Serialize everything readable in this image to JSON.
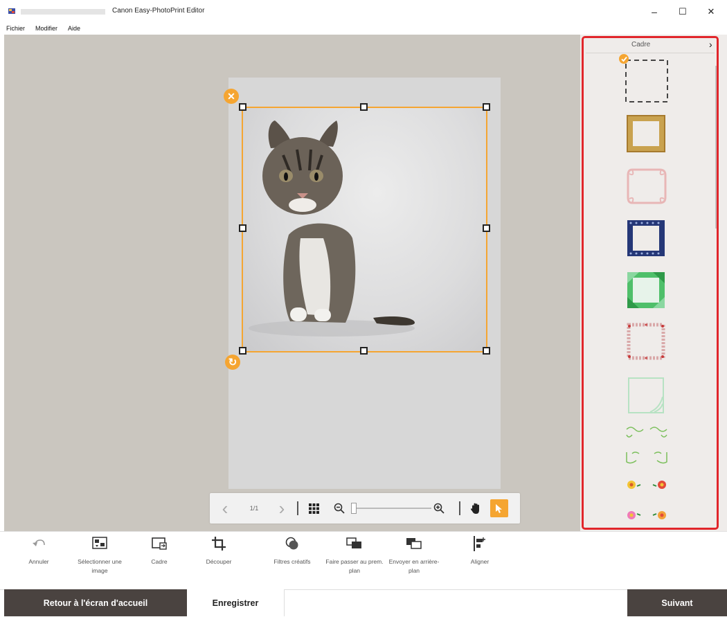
{
  "window": {
    "title": "Canon Easy-PhotoPrint Editor",
    "minimize_label": "–",
    "maximize_label": "☐",
    "close_label": "✕"
  },
  "menu": {
    "items": [
      "Fichier",
      "Modifier",
      "Aide"
    ]
  },
  "canvas": {
    "remove_glyph": "✕",
    "rotate_glyph": "↻"
  },
  "navigation": {
    "prev_glyph": "‹",
    "page_indicator": "1/1",
    "next_glyph": "›",
    "zoom_level": 0.02
  },
  "panel": {
    "title": "Cadre",
    "close_glyph": "›",
    "frames": [
      {
        "name": "none",
        "selected": true
      },
      {
        "name": "gold",
        "selected": false
      },
      {
        "name": "pink-ornate",
        "selected": false
      },
      {
        "name": "navy-dots",
        "selected": false
      },
      {
        "name": "green-geometric",
        "selected": false
      },
      {
        "name": "floral-red",
        "selected": false
      },
      {
        "name": "mint-corner",
        "selected": false
      },
      {
        "name": "green-vines",
        "selected": false
      },
      {
        "name": "green-vines-2",
        "selected": false
      },
      {
        "name": "flowers",
        "selected": false
      }
    ]
  },
  "toolbar": {
    "undo_label": "Annuler",
    "select_image_label": "Sélectionner une image",
    "frame_label": "Cadre",
    "crop_label": "Découper",
    "filters_label": "Filtres créatifs",
    "bring_front_label": "Faire passer au prem. plan",
    "send_back_label": "Envoyer en arrière-plan",
    "align_label": "Aligner"
  },
  "footer": {
    "home_label": "Retour à l'écran d'accueil",
    "save_label": "Enregistrer",
    "next_label": "Suivant"
  },
  "colors": {
    "accent": "#f5a531",
    "highlight": "#e1262b",
    "dark_button": "#4a4340",
    "workspace": "#cac6bf"
  }
}
